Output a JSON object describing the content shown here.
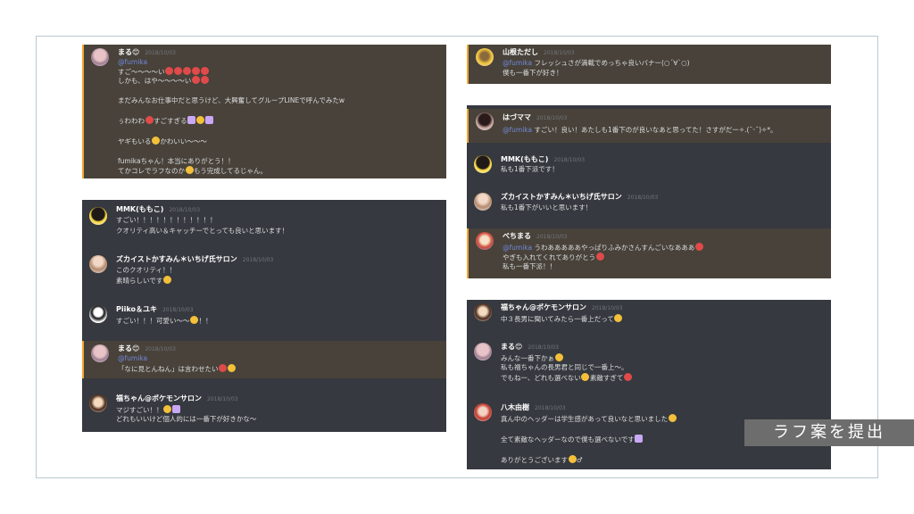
{
  "badge": "ラフ案を提出",
  "mention": "@fumika",
  "mention_left": "@fumika",
  "panels": {
    "p1": {
      "m1": {
        "name": "まる😊",
        "time": "2018/10/03",
        "lines": [
          "すご〜〜〜〜い",
          "しかも、はや〜〜〜〜い",
          "まだみんなお仕事中だと思うけど、大興奮してグループLINEで呼んでみたw",
          "ぅわわわ",
          "すごすぎる",
          "ヤギもいる",
          "かわいい〜〜〜",
          "fumikaちゃん！本当にありがとう！！",
          "てかコレでラフなのか",
          "もう完成してるじゃん。"
        ]
      }
    },
    "p2": {
      "m1": {
        "name": "MMK(ももこ)",
        "time": "2018/10/03",
        "lines": [
          "すごい！！！！！！！！！！！！",
          "クオリティ高い＆キャッチーでとっても良いと思います！"
        ]
      },
      "m2": {
        "name": "ズカイストかすみん＊いちげ氏サロン",
        "time": "2018/10/03",
        "lines": [
          "このクオリティ！！",
          "素晴らしいです"
        ]
      },
      "m3": {
        "name": "Piiko＆ユキ",
        "time": "2018/10/03",
        "lines": [
          "すごい！！！可愛い〜〜",
          "！！"
        ]
      },
      "m4": {
        "name": "まる😊",
        "time": "2018/10/03",
        "lines": [
          "「なに見とんねん」は言わせたい"
        ]
      },
      "m5": {
        "name": "福ちゃん@ポケモンサロン",
        "time": "2018/10/03",
        "lines": [
          "マジすごい！！",
          "どれもいいけど個人的には一番下が好きかな〜"
        ]
      }
    },
    "p3": {
      "m1": {
        "name": "山根ただし",
        "time": "2018/10/03",
        "lines": [
          "フレッシュさが満載でめっちゃ良いバナー(○´∀`○)",
          "僕も一番下が好き！"
        ]
      }
    },
    "p4": {
      "m1": {
        "name": "はづママ",
        "time": "2018/10/03",
        "lines": [
          "すごい！良い！あたしも1番下のが良いなあと思ってた！さすがだー✧.(˘ᵕ˘)✧*。"
        ]
      },
      "m2": {
        "name": "MMK(ももこ)",
        "time": "2018/10/03",
        "lines": [
          "私も1番下派です！"
        ]
      },
      "m3": {
        "name": "ズカイストかすみん＊いちげ氏サロン",
        "time": "2018/10/03",
        "lines": [
          "私も1番下がいいと思います！"
        ]
      },
      "m4": {
        "name": "べちまる",
        "time": "2018/10/03",
        "lines": [
          "うわあああああやっぱりふみかさんすんごいなあああ",
          "やぎも入れてくれてありがとう",
          "私も一番下派！！"
        ]
      }
    },
    "p5": {
      "m1": {
        "name": "福ちゃん@ポケモンサロン",
        "time": "2018/10/03",
        "lines": [
          "中３長男に聞いてみたら一番上だって"
        ]
      },
      "m2": {
        "name": "まる😊",
        "time": "2018/10/03",
        "lines": [
          "みんな一番下かぁ",
          "私も福ちゃんの長男君と同じで一番上〜。",
          "でもねー、どれも選べない",
          "素敵すぎて"
        ]
      },
      "m3": {
        "name": "八木由樹",
        "time": "2018/10/03",
        "lines": [
          "真ん中のヘッダーは学生感があって良いなと思いました",
          "全て素敵なヘッダーなので僕も選べないです",
          "ありがとうございます",
          "♂"
        ]
      }
    }
  }
}
